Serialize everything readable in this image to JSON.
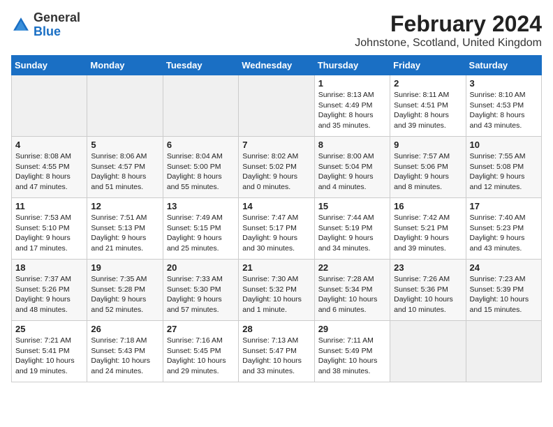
{
  "header": {
    "logo_general": "General",
    "logo_blue": "Blue",
    "month_year": "February 2024",
    "location": "Johnstone, Scotland, United Kingdom"
  },
  "days_of_week": [
    "Sunday",
    "Monday",
    "Tuesday",
    "Wednesday",
    "Thursday",
    "Friday",
    "Saturday"
  ],
  "weeks": [
    [
      {
        "day": "",
        "content": ""
      },
      {
        "day": "",
        "content": ""
      },
      {
        "day": "",
        "content": ""
      },
      {
        "day": "",
        "content": ""
      },
      {
        "day": "1",
        "content": "Sunrise: 8:13 AM\nSunset: 4:49 PM\nDaylight: 8 hours\nand 35 minutes."
      },
      {
        "day": "2",
        "content": "Sunrise: 8:11 AM\nSunset: 4:51 PM\nDaylight: 8 hours\nand 39 minutes."
      },
      {
        "day": "3",
        "content": "Sunrise: 8:10 AM\nSunset: 4:53 PM\nDaylight: 8 hours\nand 43 minutes."
      }
    ],
    [
      {
        "day": "4",
        "content": "Sunrise: 8:08 AM\nSunset: 4:55 PM\nDaylight: 8 hours\nand 47 minutes."
      },
      {
        "day": "5",
        "content": "Sunrise: 8:06 AM\nSunset: 4:57 PM\nDaylight: 8 hours\nand 51 minutes."
      },
      {
        "day": "6",
        "content": "Sunrise: 8:04 AM\nSunset: 5:00 PM\nDaylight: 8 hours\nand 55 minutes."
      },
      {
        "day": "7",
        "content": "Sunrise: 8:02 AM\nSunset: 5:02 PM\nDaylight: 9 hours\nand 0 minutes."
      },
      {
        "day": "8",
        "content": "Sunrise: 8:00 AM\nSunset: 5:04 PM\nDaylight: 9 hours\nand 4 minutes."
      },
      {
        "day": "9",
        "content": "Sunrise: 7:57 AM\nSunset: 5:06 PM\nDaylight: 9 hours\nand 8 minutes."
      },
      {
        "day": "10",
        "content": "Sunrise: 7:55 AM\nSunset: 5:08 PM\nDaylight: 9 hours\nand 12 minutes."
      }
    ],
    [
      {
        "day": "11",
        "content": "Sunrise: 7:53 AM\nSunset: 5:10 PM\nDaylight: 9 hours\nand 17 minutes."
      },
      {
        "day": "12",
        "content": "Sunrise: 7:51 AM\nSunset: 5:13 PM\nDaylight: 9 hours\nand 21 minutes."
      },
      {
        "day": "13",
        "content": "Sunrise: 7:49 AM\nSunset: 5:15 PM\nDaylight: 9 hours\nand 25 minutes."
      },
      {
        "day": "14",
        "content": "Sunrise: 7:47 AM\nSunset: 5:17 PM\nDaylight: 9 hours\nand 30 minutes."
      },
      {
        "day": "15",
        "content": "Sunrise: 7:44 AM\nSunset: 5:19 PM\nDaylight: 9 hours\nand 34 minutes."
      },
      {
        "day": "16",
        "content": "Sunrise: 7:42 AM\nSunset: 5:21 PM\nDaylight: 9 hours\nand 39 minutes."
      },
      {
        "day": "17",
        "content": "Sunrise: 7:40 AM\nSunset: 5:23 PM\nDaylight: 9 hours\nand 43 minutes."
      }
    ],
    [
      {
        "day": "18",
        "content": "Sunrise: 7:37 AM\nSunset: 5:26 PM\nDaylight: 9 hours\nand 48 minutes."
      },
      {
        "day": "19",
        "content": "Sunrise: 7:35 AM\nSunset: 5:28 PM\nDaylight: 9 hours\nand 52 minutes."
      },
      {
        "day": "20",
        "content": "Sunrise: 7:33 AM\nSunset: 5:30 PM\nDaylight: 9 hours\nand 57 minutes."
      },
      {
        "day": "21",
        "content": "Sunrise: 7:30 AM\nSunset: 5:32 PM\nDaylight: 10 hours\nand 1 minute."
      },
      {
        "day": "22",
        "content": "Sunrise: 7:28 AM\nSunset: 5:34 PM\nDaylight: 10 hours\nand 6 minutes."
      },
      {
        "day": "23",
        "content": "Sunrise: 7:26 AM\nSunset: 5:36 PM\nDaylight: 10 hours\nand 10 minutes."
      },
      {
        "day": "24",
        "content": "Sunrise: 7:23 AM\nSunset: 5:39 PM\nDaylight: 10 hours\nand 15 minutes."
      }
    ],
    [
      {
        "day": "25",
        "content": "Sunrise: 7:21 AM\nSunset: 5:41 PM\nDaylight: 10 hours\nand 19 minutes."
      },
      {
        "day": "26",
        "content": "Sunrise: 7:18 AM\nSunset: 5:43 PM\nDaylight: 10 hours\nand 24 minutes."
      },
      {
        "day": "27",
        "content": "Sunrise: 7:16 AM\nSunset: 5:45 PM\nDaylight: 10 hours\nand 29 minutes."
      },
      {
        "day": "28",
        "content": "Sunrise: 7:13 AM\nSunset: 5:47 PM\nDaylight: 10 hours\nand 33 minutes."
      },
      {
        "day": "29",
        "content": "Sunrise: 7:11 AM\nSunset: 5:49 PM\nDaylight: 10 hours\nand 38 minutes."
      },
      {
        "day": "",
        "content": ""
      },
      {
        "day": "",
        "content": ""
      }
    ]
  ]
}
